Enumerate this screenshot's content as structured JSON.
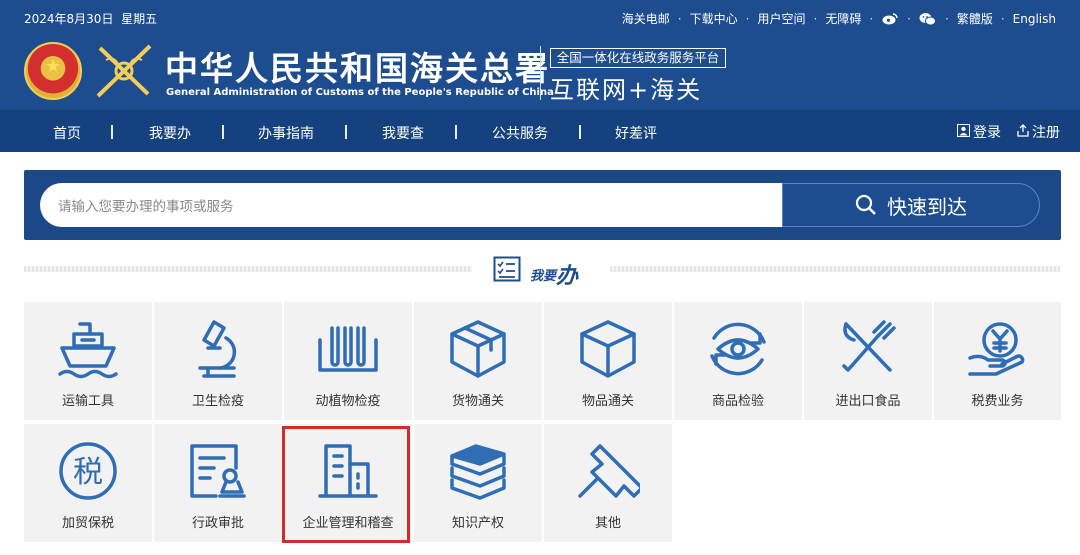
{
  "topbar": {
    "date": "2024年8月30日",
    "weekday": "星期五",
    "links": [
      "海关电邮",
      "下载中心",
      "用户空间",
      "无障碍"
    ],
    "weibo_icon": "weibo-icon",
    "wechat_icon": "wechat-icon",
    "lang_traditional": "繁體版",
    "lang_english": "English",
    "sep": "·"
  },
  "header": {
    "title_cn": "中华人民共和国海关总署",
    "title_en": "General Administration of Customs of the People's Republic of China",
    "platform_small": "全国一体化在线政务服务平台",
    "platform_big": "互联网+海关"
  },
  "nav": {
    "items": [
      "首页",
      "我要办",
      "办事指南",
      "我要查",
      "公共服务",
      "好差评"
    ],
    "login": "登录",
    "register": "注册"
  },
  "search": {
    "placeholder": "请输入您要办理的事项或服务",
    "button_label": "快速到达"
  },
  "section": {
    "title_small": "我要",
    "title_big": "办"
  },
  "services": [
    {
      "label": "运输工具",
      "icon": "ship-icon"
    },
    {
      "label": "卫生检疫",
      "icon": "microscope-icon"
    },
    {
      "label": "动植物检疫",
      "icon": "test-tubes-icon"
    },
    {
      "label": "货物通关",
      "icon": "cargo-box-icon"
    },
    {
      "label": "物品通关",
      "icon": "package-icon"
    },
    {
      "label": "商品检验",
      "icon": "eye-inspection-icon"
    },
    {
      "label": "进出口食品",
      "icon": "fork-knife-icon"
    },
    {
      "label": "税费业务",
      "icon": "yuan-hand-icon"
    },
    {
      "label": "加贸保税",
      "icon": "tax-seal-icon"
    },
    {
      "label": "行政审批",
      "icon": "approval-doc-icon"
    },
    {
      "label": "企业管理和稽查",
      "icon": "building-icon"
    },
    {
      "label": "知识产权",
      "icon": "books-icon"
    },
    {
      "label": "其他",
      "icon": "pushpin-icon"
    }
  ],
  "colors": {
    "header_bg": "#1d4c8f",
    "nav_bg": "#15427f",
    "icon_blue": "#2f6db5",
    "highlight_red": "#d12b2b"
  }
}
